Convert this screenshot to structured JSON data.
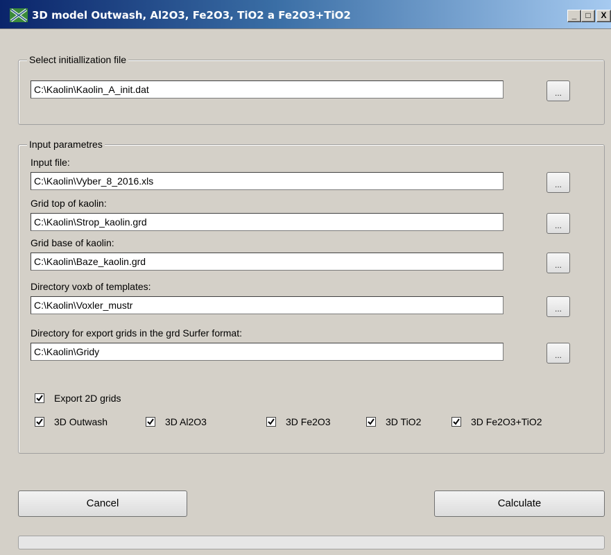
{
  "window": {
    "title": "3D model Outwash, Al2O3, Fe2O3, TiO2 a Fe2O3+TiO2",
    "minimize_icon": "_",
    "maximize_icon": "□",
    "close_icon": "X"
  },
  "init_group": {
    "title": "Select initiallization file",
    "file_value": "C:\\Kaolin\\Kaolin_A_init.dat",
    "browse_label": "..."
  },
  "params_group": {
    "title": "Input parametres",
    "fields": [
      {
        "label": "Input file:",
        "value": "C:\\Kaolin\\Vyber_8_2016.xls",
        "browse_label": "..."
      },
      {
        "label": "Grid top of kaolin:",
        "value": "C:\\Kaolin\\Strop_kaolin.grd",
        "browse_label": "..."
      },
      {
        "label": "Grid base of kaolin:",
        "value": "C:\\Kaolin\\Baze_kaolin.grd",
        "browse_label": "..."
      },
      {
        "label": "Directory voxb of templates:",
        "value": "C:\\Kaolin\\Voxler_mustr",
        "browse_label": "..."
      },
      {
        "label": "Directory for export grids in the grd Surfer format:",
        "value": "C:\\Kaolin\\Gridy",
        "browse_label": "..."
      }
    ],
    "export_2d": {
      "label": "Export 2D grids",
      "checked": true
    },
    "models": [
      {
        "label": "3D Outwash",
        "checked": true
      },
      {
        "label": "3D Al2O3",
        "checked": true
      },
      {
        "label": "3D Fe2O3",
        "checked": true
      },
      {
        "label": "3D TiO2",
        "checked": true
      },
      {
        "label": "3D Fe2O3+TiO2",
        "checked": true
      }
    ]
  },
  "buttons": {
    "cancel": "Cancel",
    "calculate": "Calculate"
  },
  "progress": {
    "value": 0
  },
  "colors": {
    "title_start": "#0a246a",
    "title_end": "#a6caf0",
    "window_bg": "#d4d0c8"
  }
}
